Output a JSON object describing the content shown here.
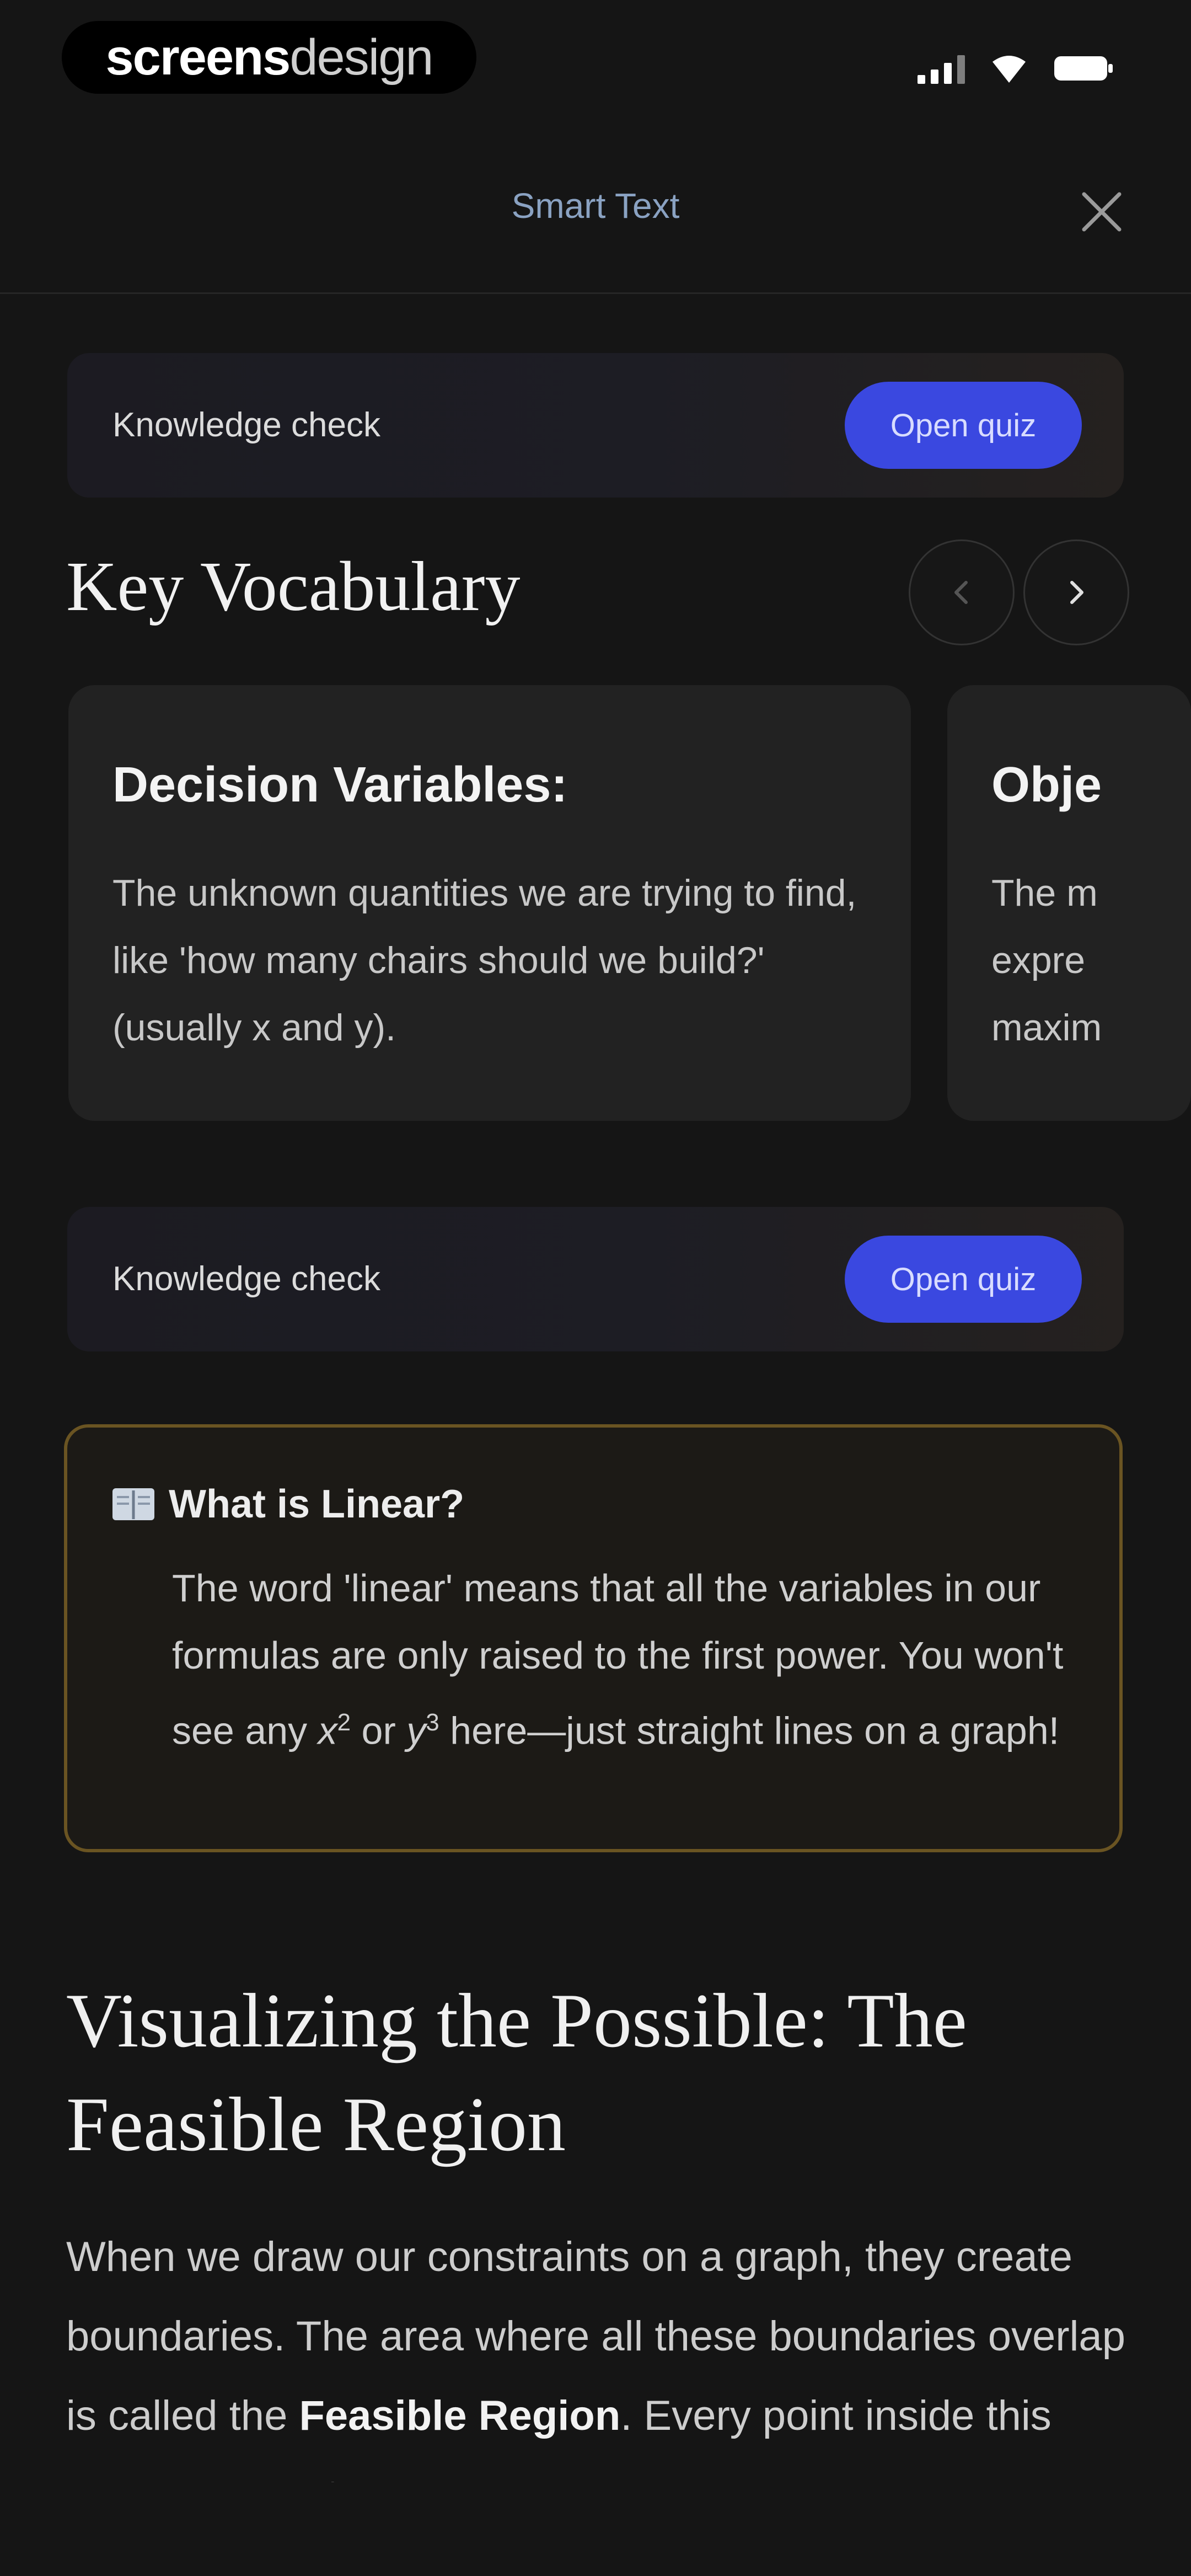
{
  "brand": {
    "part1": "screens",
    "part2": "design"
  },
  "header": {
    "title": "Smart Text"
  },
  "knowledge_checks": [
    {
      "label": "Knowledge check",
      "button": "Open quiz"
    },
    {
      "label": "Knowledge check",
      "button": "Open quiz"
    }
  ],
  "vocabulary": {
    "title": "Key Vocabulary",
    "cards": [
      {
        "term": "Decision Variables:",
        "definition": "The unknown quantities we are trying to find, like 'how many chairs should we build?' (usually x and y)."
      },
      {
        "term": "Obje",
        "definition": "The m expre maxim"
      }
    ]
  },
  "callout": {
    "icon": "book-icon",
    "title": "What is Linear?",
    "text_before_x": "The word 'linear' means that all the variables in our formulas are only raised to the first power. You won't see any ",
    "var_x": "x",
    "sup_x": "2",
    "text_or": " or ",
    "var_y": "y",
    "sup_y": "3",
    "text_after": " here—just straight lines on a graph!"
  },
  "section": {
    "title": "Visualizing the Possible: The Feasible Region",
    "body_start": "When we draw our constraints on a graph, they create boundaries. The area where all these boundaries overlap is called the ",
    "body_bold": "Feasible Region",
    "body_end": ". Every point inside this area represents"
  },
  "colors": {
    "background": "#151515",
    "accent_button": "#3a48e0",
    "callout_border": "#6a5422"
  }
}
